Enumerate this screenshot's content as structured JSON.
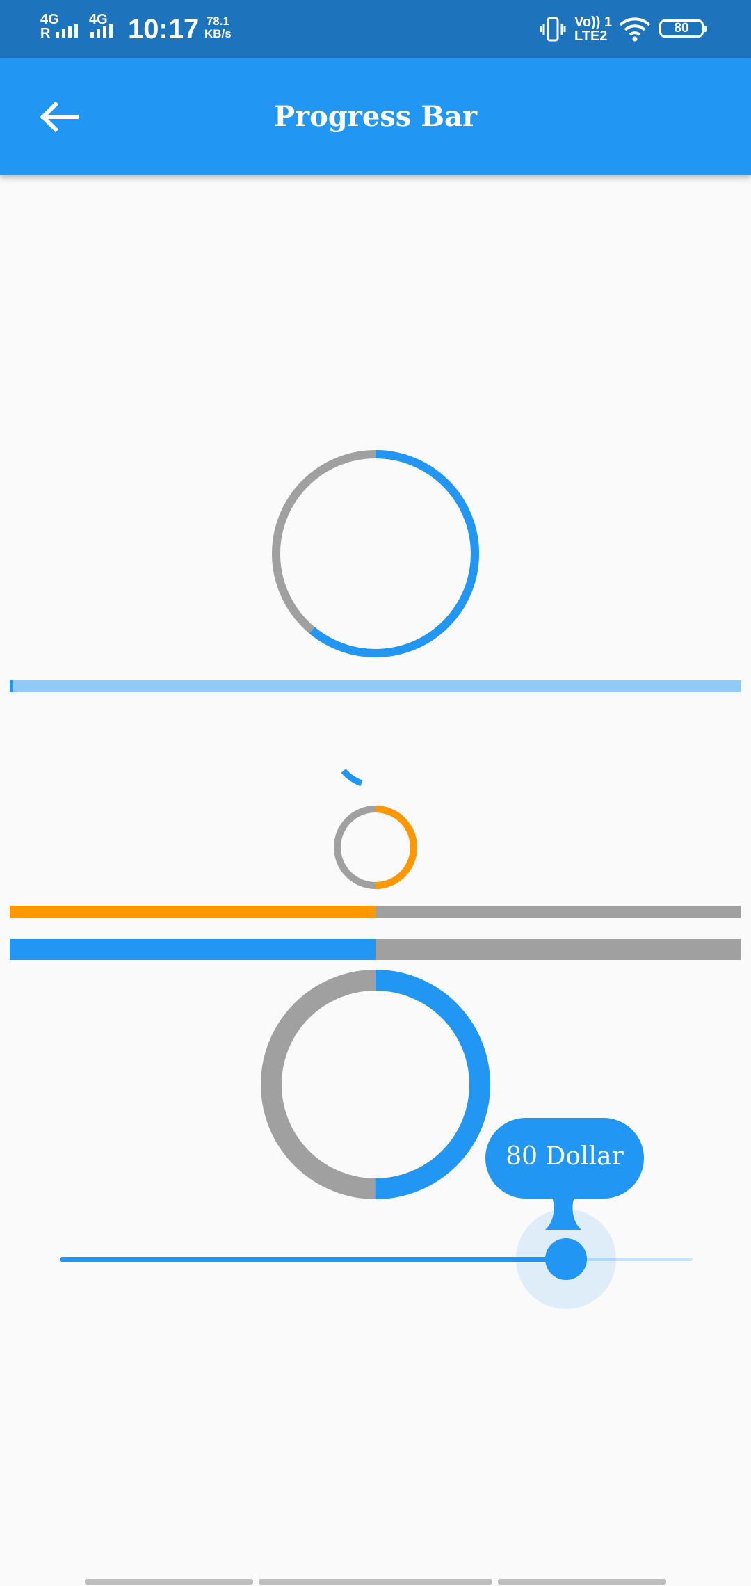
{
  "status_bar": {
    "net1_top": "4G",
    "net1_bottom": "R",
    "net2_top": "4G",
    "time": "10:17",
    "speed_value": "78.1",
    "speed_unit": "KB/s",
    "volte": "Vo)) 1",
    "lte": "LTE2",
    "battery": "80",
    "icons": [
      "signal-icon",
      "signal-icon",
      "vibrate-icon",
      "wifi-icon",
      "battery-icon"
    ]
  },
  "app_bar": {
    "title": "Progress Bar",
    "back_icon": "arrow-back-icon"
  },
  "progress": {
    "circular_large": {
      "value": 0.61,
      "color": "#2196f3",
      "track": "#a0a0a0"
    },
    "linear_thin": {
      "value": 0.003,
      "color": "#2196f3",
      "track": "#90caf9"
    },
    "circular_spinner": {
      "state": "indeterminate",
      "color": "#2196f3"
    },
    "circular_small": {
      "value": 0.5,
      "color": "#ff9800",
      "track": "#a0a0a0"
    },
    "linear_orange": {
      "value": 0.5,
      "color": "#ff9800",
      "track": "#a0a0a0"
    },
    "linear_blue": {
      "value": 0.5,
      "color": "#2196f3",
      "track": "#a0a0a0"
    },
    "circular_thick": {
      "value": 0.5,
      "color": "#2196f3",
      "track": "#a0a0a0"
    }
  },
  "slider": {
    "value": 80,
    "min": 0,
    "max": 100,
    "label": "80 Dollar",
    "color": "#2196f3"
  }
}
